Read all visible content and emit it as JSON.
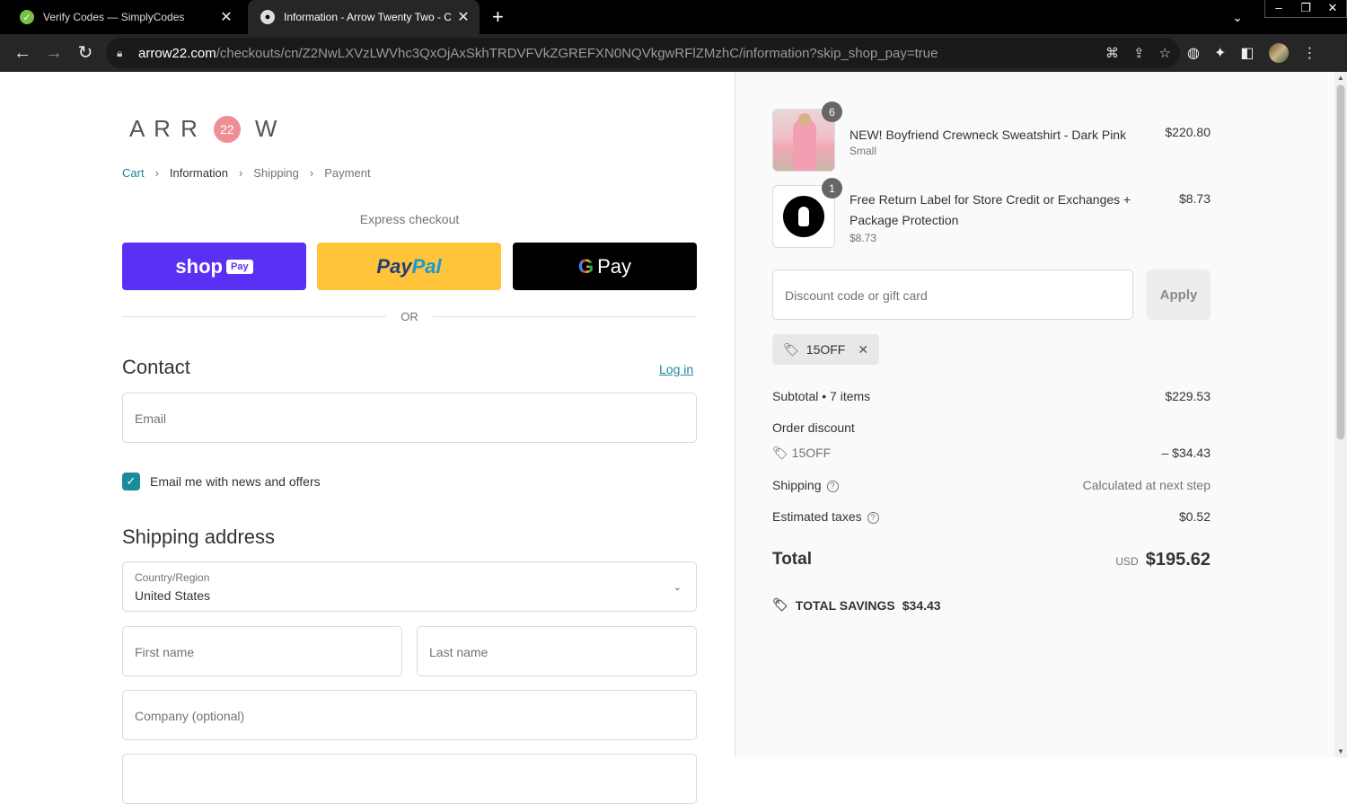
{
  "browser": {
    "tabs": [
      {
        "title": "Verify Codes — SimplyCodes",
        "active": false
      },
      {
        "title": "Information - Arrow Twenty Two - Ch",
        "active": true
      }
    ],
    "url_host": "arrow22.com",
    "url_path": "/checkouts/cn/Z2NwLXVzLWVhc3QxOjAxSkhTRDVFVkZGREFXN0NQVkgwRFlZMzhC/information?skip_shop_pay=true"
  },
  "logo": {
    "letters": "A R R",
    "badge": "22",
    "last": "W"
  },
  "breadcrumb": {
    "cart": "Cart",
    "information": "Information",
    "shipping": "Shipping",
    "payment": "Payment"
  },
  "express": {
    "title": "Express checkout",
    "shop_label": "shop",
    "shop_tag": "Pay",
    "paypal_1": "Pay",
    "paypal_2": "Pal",
    "gpay_g": "G",
    "gpay_label": "Pay",
    "or": "OR"
  },
  "contact": {
    "heading": "Contact",
    "login": "Log in",
    "email_placeholder": "Email",
    "newsletter_label": "Email me with news and offers",
    "newsletter_checked": true
  },
  "shipping_address": {
    "heading": "Shipping address",
    "country_label": "Country/Region",
    "country_value": "United States",
    "first_name_placeholder": "First name",
    "last_name_placeholder": "Last name",
    "company_placeholder": "Company (optional)"
  },
  "summary": {
    "items": [
      {
        "name": "NEW! Boyfriend Crewneck Sweatshirt - Dark Pink",
        "variant": "Small",
        "qty": "6",
        "price": "$220.80"
      },
      {
        "name": "Free Return Label for Store Credit or Exchanges + Package Protection",
        "variant": "$8.73",
        "qty": "1",
        "price": "$8.73"
      }
    ],
    "discount_placeholder": "Discount code or gift card",
    "apply_label": "Apply",
    "applied_code": "15OFF",
    "subtotal_label": "Subtotal • 7 items",
    "subtotal_value": "$229.53",
    "order_discount_label": "Order discount",
    "order_discount_code": "15OFF",
    "order_discount_value": "– $34.43",
    "shipping_label": "Shipping",
    "shipping_value": "Calculated at next step",
    "taxes_label": "Estimated taxes",
    "taxes_value": "$0.52",
    "total_label": "Total",
    "total_currency": "USD",
    "total_value": "$195.62",
    "savings_label": "TOTAL SAVINGS",
    "savings_value": "$34.43"
  },
  "colors": {
    "accent": "#1b8a9a",
    "shop_pay": "#5a31f4",
    "paypal": "#ffc439",
    "logo_badge": "#ef8f95"
  }
}
